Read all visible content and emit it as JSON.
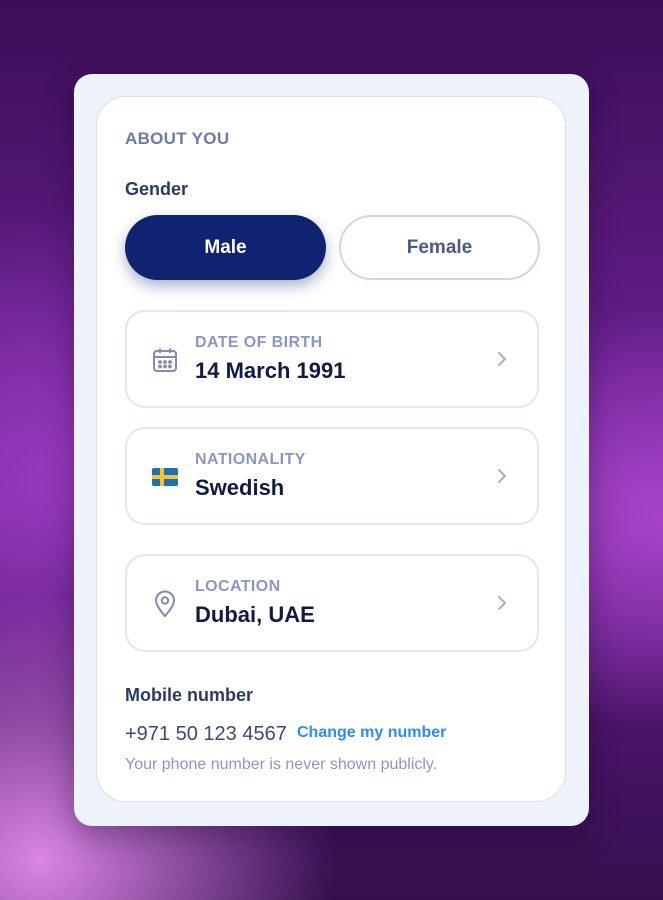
{
  "section": {
    "title": "ABOUT YOU"
  },
  "gender": {
    "label": "Gender",
    "options": [
      {
        "label": "Male",
        "selected": true
      },
      {
        "label": "Female",
        "selected": false
      }
    ]
  },
  "fields": [
    {
      "label": "DATE OF BIRTH",
      "value": "14 March 1991",
      "icon": "calendar-icon"
    },
    {
      "label": "NATIONALITY",
      "value": "Swedish",
      "icon": "flag-sweden-icon",
      "flag": "🇸🇪"
    },
    {
      "label": "LOCATION",
      "value": "Dubai, UAE",
      "icon": "location-pin-icon"
    }
  ],
  "mobile": {
    "label": "Mobile number",
    "number": "+971 50 123 4567",
    "change_label": "Change my number",
    "note": "Your phone number is never shown publicly."
  },
  "colors": {
    "primary": "#0f2370",
    "link": "#2d8cf0",
    "muted": "#8a98bd",
    "heading": "#2a3b66"
  }
}
